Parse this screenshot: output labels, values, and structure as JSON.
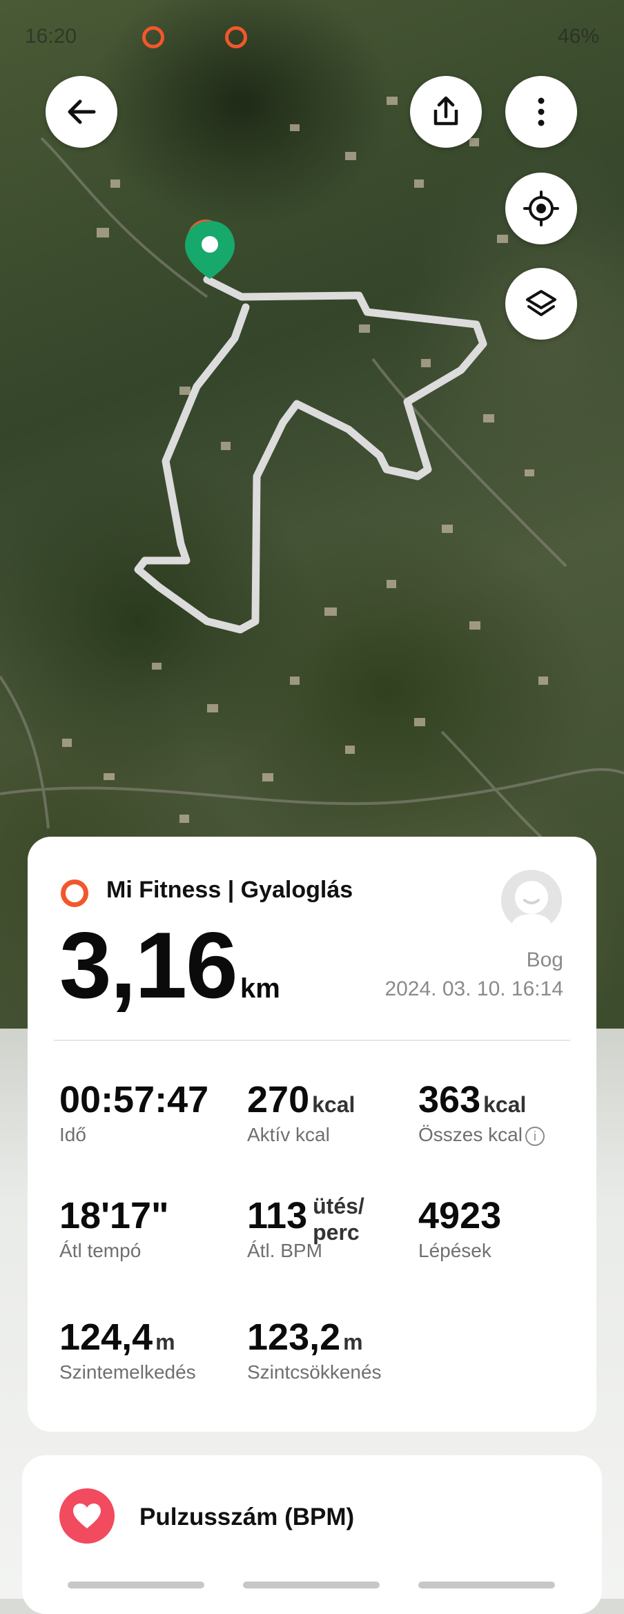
{
  "status_bar": {
    "time": "16:20",
    "battery": "46%"
  },
  "colors": {
    "accent": "#f2572c",
    "route": "#e4e4e4",
    "start_pin": "#17a86b",
    "heart": "#f24a5e"
  },
  "map": {
    "buttons": [
      "back-arrow-icon",
      "share-icon",
      "more-vert-icon",
      "my-location-icon",
      "layers-icon"
    ]
  },
  "workout": {
    "source": "Mi Fitness | Gyaloglás",
    "distance_value": "3,16",
    "distance_unit": "km",
    "user_name": "Bog",
    "datetime": "2024. 03. 10. 16:14"
  },
  "stats": [
    {
      "value": "00:57:47",
      "unit": "",
      "label": "Idő"
    },
    {
      "value": "270",
      "unit": "kcal",
      "label": "Aktív kcal"
    },
    {
      "value": "363",
      "unit": "kcal",
      "label": "Összes kcal"
    },
    {
      "value": "18'17\"",
      "unit": "",
      "label": "Átl tempó"
    },
    {
      "value": "113",
      "unit_line1": "ütés/",
      "unit_line2": "perc",
      "label": "Átl. BPM"
    },
    {
      "value": "4923",
      "unit": "",
      "label": "Lépések"
    },
    {
      "value": "124,4",
      "unit": "m",
      "label": "Szintemelkedés"
    },
    {
      "value": "123,2",
      "unit": "m",
      "label": "Szintcsökkenés"
    }
  ],
  "heart_section": {
    "title": "Pulzusszám (BPM)"
  }
}
